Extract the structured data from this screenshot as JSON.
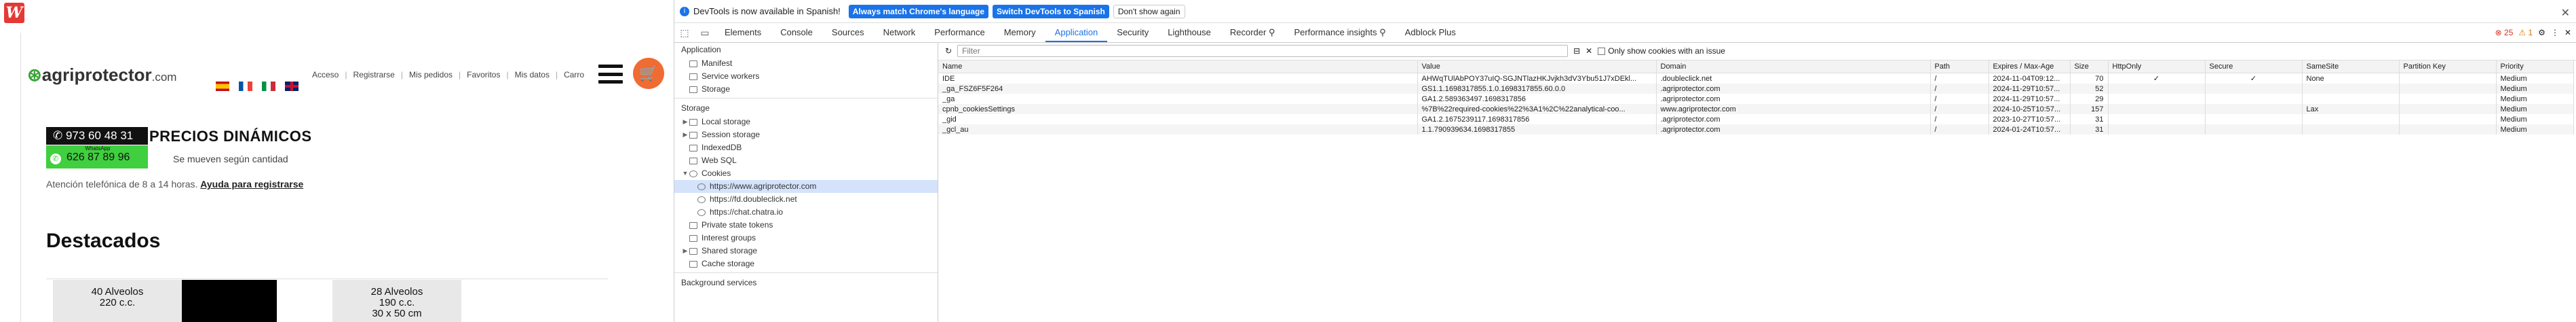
{
  "site": {
    "logo_main": "agriprotector",
    "logo_domain": ".com",
    "nav": [
      "Acceso",
      "Registrarse",
      "Mis pedidos",
      "Favoritos",
      "Mis datos",
      "Carro"
    ],
    "phone": "973 60 48 31",
    "whatsapp_label": "WhatsApp",
    "whatsapp_number": "626 87 89 96",
    "headline": "PRECIOS DINÁMICOS",
    "subline": "Se mueven según cantidad",
    "support_text": "Atención telefónica de 8 a 14 horas.",
    "support_link": "Ayuda para registrarse",
    "section_title": "Destacados",
    "products": [
      {
        "line1": "40 Alveolos",
        "line2": "220 c.c."
      },
      {
        "line1": "28 Alveolos",
        "line2": "190 c.c.",
        "line3": "30 x 50 cm"
      }
    ],
    "colors": {
      "accent": "#3aa335",
      "cart": "#ef6c33",
      "brand_red": "#e53935"
    }
  },
  "devtools": {
    "infobar": {
      "message": "DevTools is now available in Spanish!",
      "btn_match": "Always match Chrome's language",
      "btn_switch": "Switch DevTools to Spanish",
      "btn_dismiss": "Don't show again"
    },
    "tabs": [
      "Elements",
      "Console",
      "Sources",
      "Network",
      "Performance",
      "Memory",
      "Application",
      "Security",
      "Lighthouse",
      "Recorder ⚲",
      "Performance insights ⚲",
      "Adblock Plus"
    ],
    "active_tab": "Application",
    "errors": "25",
    "warnings": "1",
    "sidebar": {
      "application_title": "Application",
      "application_items": [
        "Manifest",
        "Service workers",
        "Storage"
      ],
      "storage_title": "Storage",
      "storage_items": [
        "Local storage",
        "Session storage",
        "IndexedDB",
        "Web SQL",
        "Cookies"
      ],
      "cookie_origins": [
        "https://www.agriprotector.com",
        "https://fd.doubleclick.net",
        "https://chat.chatra.io"
      ],
      "storage_more": [
        "Private state tokens",
        "Interest groups",
        "Shared storage",
        "Cache storage"
      ],
      "background_title": "Background services"
    },
    "filter_placeholder": "Filter",
    "only_issue_label": "Only show cookies with an issue",
    "columns": [
      "Name",
      "Value",
      "Domain",
      "Path",
      "Expires / Max-Age",
      "Size",
      "HttpOnly",
      "Secure",
      "SameSite",
      "Partition Key",
      "Priority"
    ],
    "rows": [
      [
        "IDE",
        "AHWqTUlAbPOY37uIQ-SGJNTlazHKJvjkh3dV3Ybu51J7xDEkl...",
        ".doubleclick.net",
        "/",
        "2024-11-04T09:12...",
        "70",
        "✓",
        "✓",
        "None",
        "",
        "Medium"
      ],
      [
        "_ga_FSZ6F5F264",
        "GS1.1.1698317855.1.0.1698317855.60.0.0",
        ".agriprotector.com",
        "/",
        "2024-11-29T10:57...",
        "52",
        "",
        "",
        "",
        "",
        "Medium"
      ],
      [
        "_ga",
        "GA1.2.589363497.1698317856",
        ".agriprotector.com",
        "/",
        "2024-11-29T10:57...",
        "29",
        "",
        "",
        "",
        "",
        "Medium"
      ],
      [
        "cpnb_cookiesSettings",
        "%7B%22required-cookies%22%3A1%2C%22analytical-coo...",
        "www.agriprotector.com",
        "/",
        "2024-10-25T10:57...",
        "157",
        "",
        "",
        "Lax",
        "",
        "Medium"
      ],
      [
        "_gid",
        "GA1.2.1675239117.1698317856",
        ".agriprotector.com",
        "/",
        "2023-10-27T10:57...",
        "31",
        "",
        "",
        "",
        "",
        "Medium"
      ],
      [
        "_gcl_au",
        "1.1.790939634.1698317855",
        ".agriprotector.com",
        "/",
        "2024-01-24T10:57...",
        "31",
        "",
        "",
        "",
        "",
        "Medium"
      ]
    ]
  }
}
